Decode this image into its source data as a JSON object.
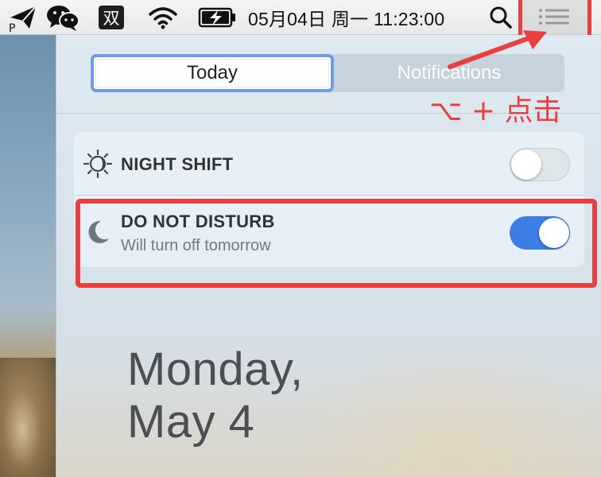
{
  "menubar": {
    "ime_badge": "双",
    "clock": "05月04日 周一 11:23:00"
  },
  "notification_center": {
    "tabs": [
      {
        "label": "Today",
        "selected": true
      },
      {
        "label": "Notifications",
        "selected": false
      }
    ],
    "night_shift": {
      "title": "NIGHT SHIFT",
      "enabled": false
    },
    "do_not_disturb": {
      "title": "DO NOT DISTURB",
      "subtitle": "Will turn off tomorrow",
      "enabled": true
    },
    "date": {
      "weekday": "Monday,",
      "day": "May 4"
    }
  },
  "annotation": {
    "text": "⌥ + 点击",
    "color": "#e84040"
  },
  "colors": {
    "accent": "#3c7de6",
    "annotation_red": "#e84040",
    "selected_tab_border": "#6f9de2"
  },
  "icons": [
    "send-icon",
    "wechat-icon",
    "wifi-icon",
    "battery-charging-icon",
    "spotlight-search-icon",
    "notification-center-icon",
    "night-shift-sun-icon",
    "moon-icon"
  ]
}
